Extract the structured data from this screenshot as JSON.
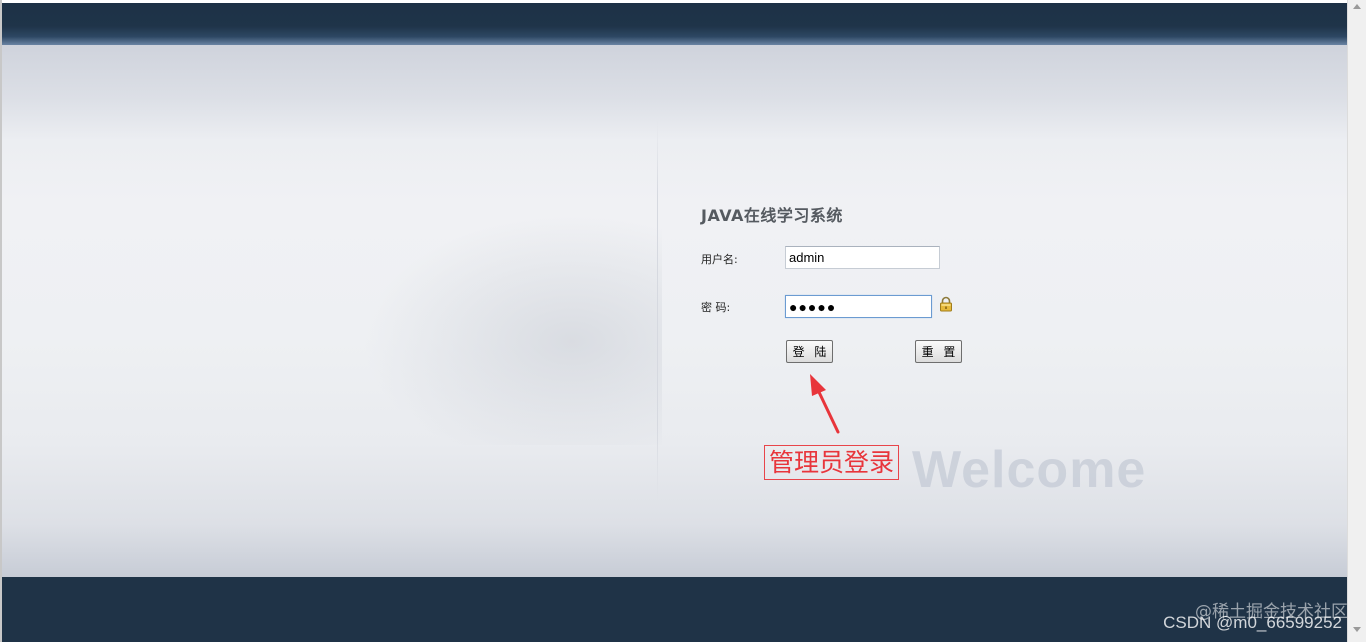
{
  "page": {
    "title": "JAVA在线学习系统"
  },
  "login_form": {
    "username_label": "用户名:",
    "username_value": "admin",
    "password_label": "密  码:",
    "password_value": "●●●●●",
    "login_button": "登 陆",
    "reset_button": "重 置"
  },
  "decor": {
    "welcome_text": "Welcome"
  },
  "annotation": {
    "text": "管理员登录",
    "color": "#e8353b"
  },
  "watermark": {
    "line1": "@稀土掘金技术社区",
    "line2": "CSDN @m0_66599252"
  },
  "colors": {
    "header_bar": "#1f3449",
    "footer_bar": "#1f3347",
    "title_text": "#555a60"
  },
  "icons": {
    "lock": "lock-icon",
    "arrow": "arrow-icon"
  }
}
